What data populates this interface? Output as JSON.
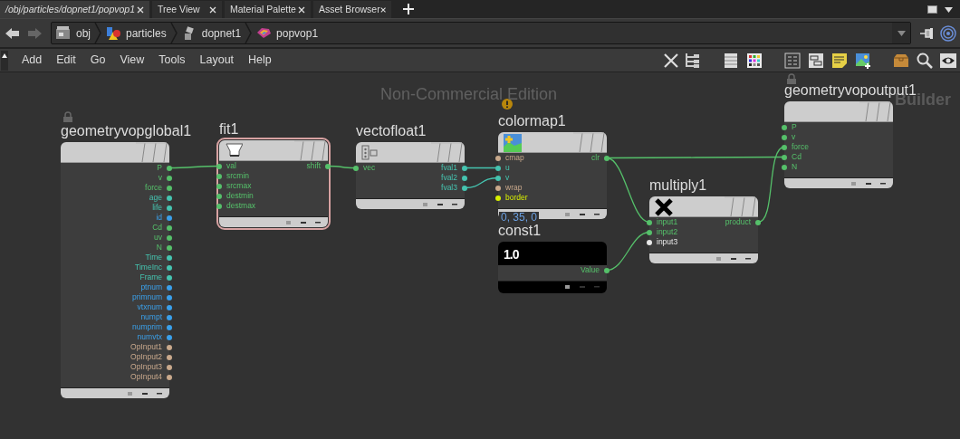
{
  "tabs": [
    {
      "label": "/obj/particles/dopnet1/popvop1",
      "selected": true
    },
    {
      "label": "Tree View",
      "selected": false
    },
    {
      "label": "Material Palette",
      "selected": false
    },
    {
      "label": "Asset Browser",
      "selected": false
    }
  ],
  "path": [
    {
      "label": "obj",
      "kind": "objects"
    },
    {
      "label": "particles",
      "kind": "geometry"
    },
    {
      "label": "dopnet1",
      "kind": "dopnet"
    },
    {
      "label": "popvop1",
      "kind": "vop"
    }
  ],
  "menu": [
    "Add",
    "Edit",
    "Go",
    "View",
    "Tools",
    "Layout",
    "Help"
  ],
  "canvas_labels": [
    "Non-Commercial Edition",
    "Builder"
  ],
  "nodes": [
    {
      "name": "geometryvopglobal1",
      "kind": "global",
      "selected": false,
      "locked": true,
      "warning": false,
      "outputs": [
        {
          "label": "P",
          "color": "#55c06a"
        },
        {
          "label": "v",
          "color": "#55c06a"
        },
        {
          "label": "force",
          "color": "#55c06a"
        },
        {
          "label": "age",
          "color": "#45c4b0"
        },
        {
          "label": "life",
          "color": "#45c4b0"
        },
        {
          "label": "id",
          "color": "#3aa0ea"
        },
        {
          "label": "Cd",
          "color": "#55c06a"
        },
        {
          "label": "uv",
          "color": "#55c06a"
        },
        {
          "label": "N",
          "color": "#55c06a"
        },
        {
          "label": "Time",
          "color": "#45c4b0"
        },
        {
          "label": "TimeInc",
          "color": "#45c4b0"
        },
        {
          "label": "Frame",
          "color": "#45c4b0"
        },
        {
          "label": "ptnum",
          "color": "#3aa0ea"
        },
        {
          "label": "primnum",
          "color": "#3aa0ea"
        },
        {
          "label": "vtxnum",
          "color": "#3aa0ea"
        },
        {
          "label": "numpt",
          "color": "#3aa0ea"
        },
        {
          "label": "numprim",
          "color": "#3aa0ea"
        },
        {
          "label": "numvtx",
          "color": "#3aa0ea"
        },
        {
          "label": "OpInput1",
          "color": "#c9a98c"
        },
        {
          "label": "OpInput2",
          "color": "#c9a98c"
        },
        {
          "label": "OpInput3",
          "color": "#c9a98c"
        },
        {
          "label": "OpInput4",
          "color": "#c9a98c"
        }
      ]
    },
    {
      "name": "fit1",
      "kind": "fit",
      "selected": true,
      "locked": false,
      "warning": false,
      "inputs": [
        {
          "label": "val",
          "color": "#55c06a"
        },
        {
          "label": "srcmin",
          "color": "#55c06a"
        },
        {
          "label": "srcmax",
          "color": "#55c06a"
        },
        {
          "label": "destmin",
          "color": "#55c06a"
        },
        {
          "label": "destmax",
          "color": "#55c06a"
        }
      ],
      "outputs": [
        {
          "label": "shift",
          "color": "#55c06a"
        }
      ]
    },
    {
      "name": "vectofloat1",
      "kind": "vectofloat",
      "selected": false,
      "locked": false,
      "warning": false,
      "inputs": [
        {
          "label": "vec",
          "color": "#55c06a"
        }
      ],
      "outputs": [
        {
          "label": "fval1",
          "color": "#45c4b0"
        },
        {
          "label": "fval2",
          "color": "#45c4b0"
        },
        {
          "label": "fval3",
          "color": "#45c4b0"
        }
      ]
    },
    {
      "name": "colormap1",
      "kind": "colormap",
      "selected": false,
      "locked": false,
      "warning": true,
      "info": "0, 35, 0",
      "inputs": [
        {
          "label": "cmap",
          "color": "#c9a98c"
        },
        {
          "label": "u",
          "color": "#45c4b0"
        },
        {
          "label": "v",
          "color": "#45c4b0"
        },
        {
          "label": "wrap",
          "color": "#c9a98c"
        },
        {
          "label": "border",
          "color": "#d8f000"
        }
      ],
      "outputs": [
        {
          "label": "clr",
          "color": "#55c06a"
        }
      ]
    },
    {
      "name": "const1",
      "kind": "constant",
      "selected": false,
      "locked": false,
      "warning": false,
      "display": "1.0",
      "outputs": [
        {
          "label": "Value",
          "color": "#55c06a"
        }
      ]
    },
    {
      "name": "multiply1",
      "kind": "multiply",
      "selected": false,
      "locked": false,
      "warning": false,
      "inputs": [
        {
          "label": "input1",
          "color": "#55c06a"
        },
        {
          "label": "input2",
          "color": "#55c06a"
        },
        {
          "label": "input3",
          "color": "#e8e8e8"
        }
      ],
      "outputs": [
        {
          "label": "product",
          "color": "#55c06a"
        }
      ]
    },
    {
      "name": "geometryvopoutput1",
      "kind": "output",
      "selected": false,
      "locked": true,
      "warning": false,
      "inputs": [
        {
          "label": "P",
          "color": "#55c06a"
        },
        {
          "label": "v",
          "color": "#55c06a"
        },
        {
          "label": "force",
          "color": "#55c06a"
        },
        {
          "label": "Cd",
          "color": "#55c06a"
        },
        {
          "label": "N",
          "color": "#55c06a"
        }
      ]
    }
  ]
}
